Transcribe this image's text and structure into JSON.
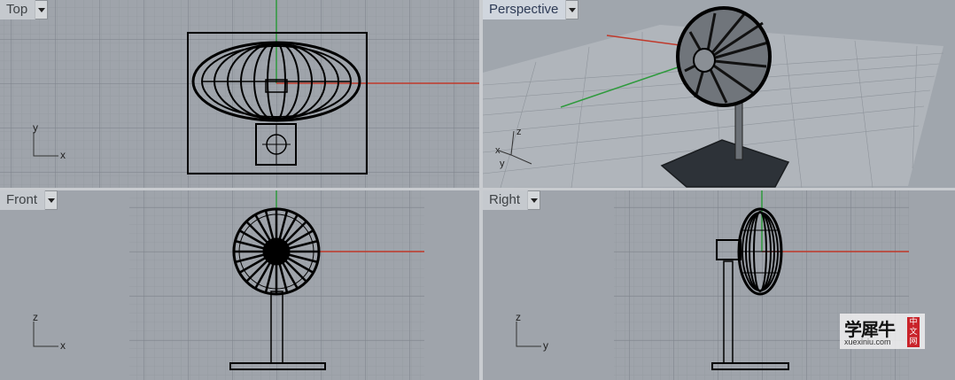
{
  "viewports": {
    "top": {
      "label": "Top",
      "axis_a": "y",
      "axis_b": "x"
    },
    "perspective": {
      "label": "Perspective",
      "axis_z": "z",
      "axis_x": "x",
      "axis_y": "y"
    },
    "front": {
      "label": "Front",
      "axis_a": "z",
      "axis_b": "x"
    },
    "right": {
      "label": "Right",
      "axis_a": "z",
      "axis_b": "y"
    }
  },
  "active_viewport": "Perspective",
  "watermark": {
    "chinese": "学犀牛",
    "domain": "xuexiniu.com",
    "badge": "中文网"
  },
  "colors": {
    "viewport_bg": "#9fa4ab",
    "x_axis": "#c0392b",
    "y_axis": "#2e9a3c",
    "grid_minor": "#8f959c",
    "grid_major": "#7b8188"
  }
}
